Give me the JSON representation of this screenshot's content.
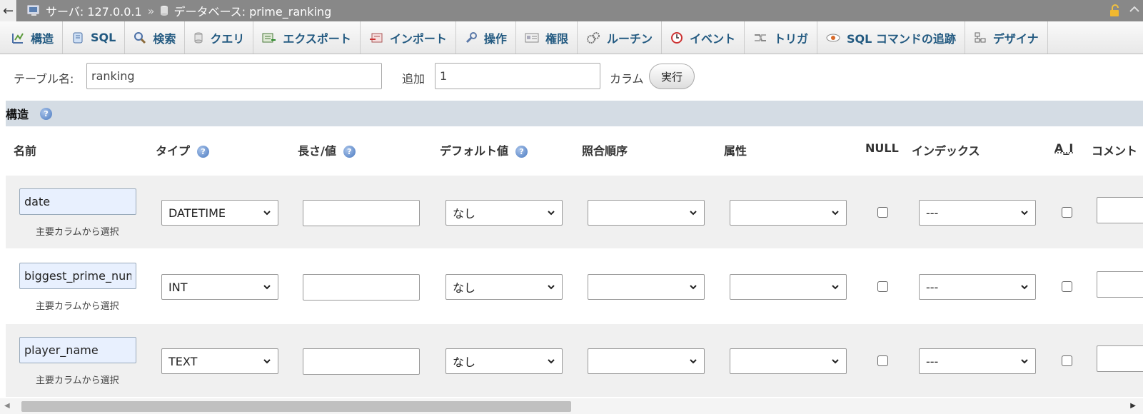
{
  "breadcrumb": {
    "back": "←",
    "server": "サーバ: 127.0.0.1",
    "separator": "»",
    "database": "データベース: prime_ranking"
  },
  "tabs": [
    {
      "label": "構造",
      "icon": "structure-icon"
    },
    {
      "label": "SQL",
      "icon": "sql-icon"
    },
    {
      "label": "検索",
      "icon": "search-icon"
    },
    {
      "label": "クエリ",
      "icon": "query-icon"
    },
    {
      "label": "エクスポート",
      "icon": "export-icon"
    },
    {
      "label": "インポート",
      "icon": "import-icon"
    },
    {
      "label": "操作",
      "icon": "wrench-icon"
    },
    {
      "label": "権限",
      "icon": "privileges-icon"
    },
    {
      "label": "ルーチン",
      "icon": "routines-icon"
    },
    {
      "label": "イベント",
      "icon": "events-icon"
    },
    {
      "label": "トリガ",
      "icon": "triggers-icon"
    },
    {
      "label": "SQL コマンドの追跡",
      "icon": "eye-icon"
    },
    {
      "label": "デザイナ",
      "icon": "designer-icon"
    }
  ],
  "form": {
    "table_name_label": "テーブル名:",
    "table_name_value": "ranking",
    "add_label": "追加",
    "add_value": "1",
    "columns_label": "カラム",
    "go_button": "実行"
  },
  "section": {
    "title": "構造"
  },
  "columns": {
    "name": "名前",
    "type": "タイプ",
    "length": "長さ/値",
    "default": "デフォルト値",
    "collation": "照合順序",
    "attributes": "属性",
    "null": "NULL",
    "index": "インデックス",
    "ai": "A_I",
    "comment": "コメント"
  },
  "rows": [
    {
      "name": "date",
      "type": "DATETIME",
      "default": "なし",
      "index": "---",
      "pick_label": "主要カラムから選択"
    },
    {
      "name": "biggest_prime_num",
      "type": "INT",
      "default": "なし",
      "index": "---",
      "pick_label": "主要カラムから選択"
    },
    {
      "name": "player_name",
      "type": "TEXT",
      "default": "なし",
      "index": "---",
      "pick_label": "主要カラムから選択"
    }
  ],
  "colors": {
    "breadcrumb_bg": "#888888",
    "tab_text": "#235a81",
    "section_bg": "#d4dce4",
    "row_shade": "#f0f0f0",
    "name_input_bg": "#e8f0fe"
  }
}
